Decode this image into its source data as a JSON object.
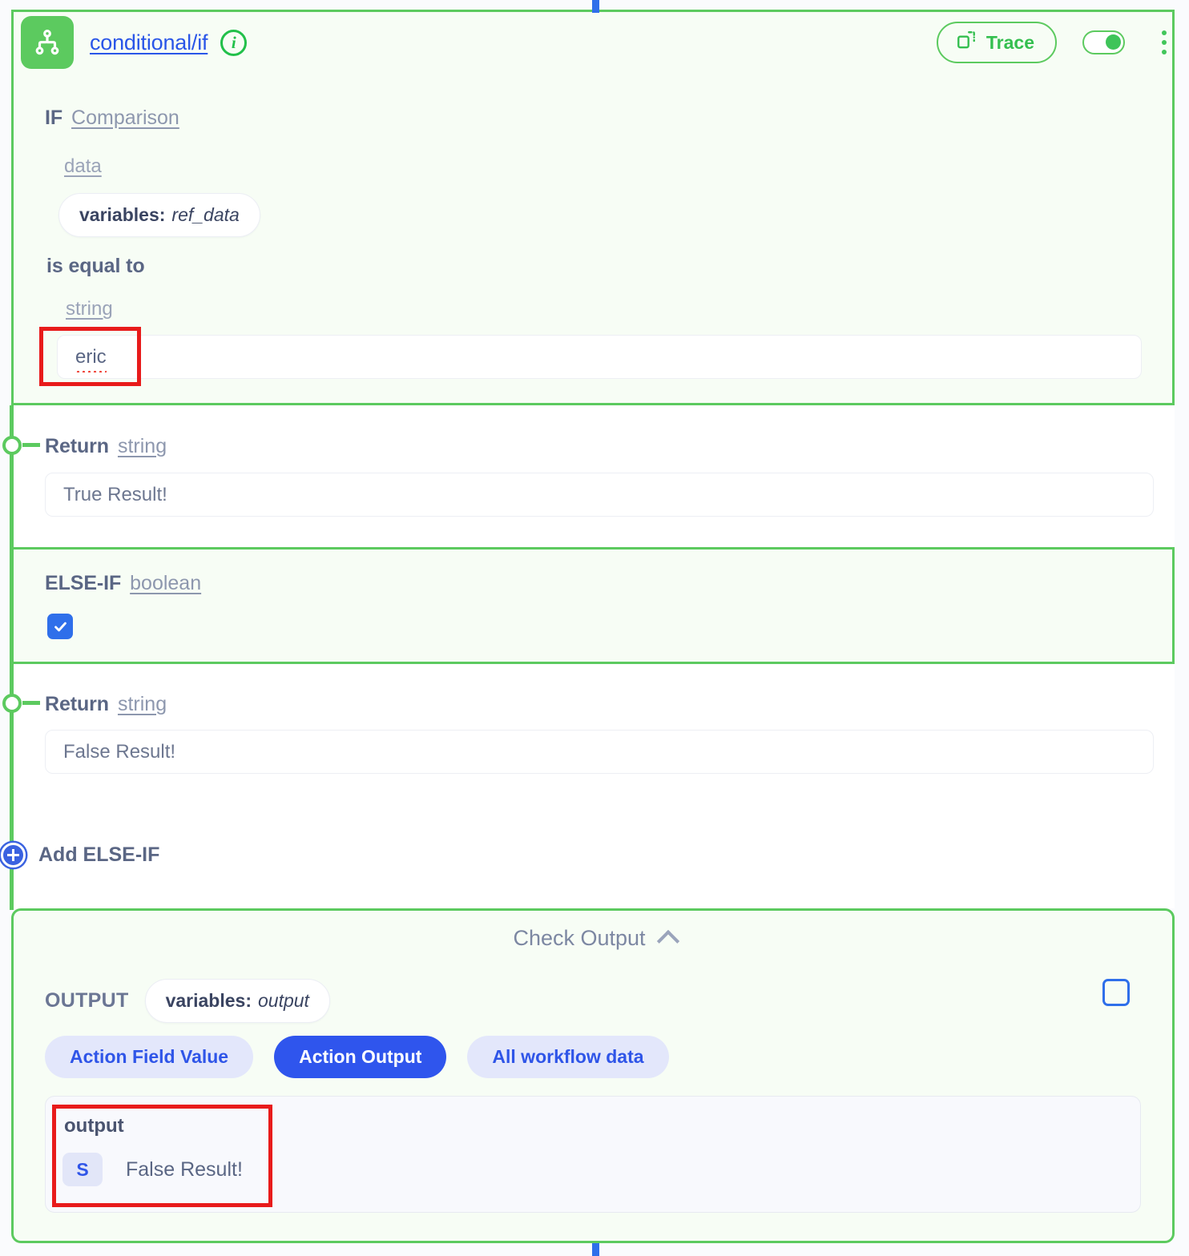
{
  "node": {
    "title": "conditional/if",
    "icon": "branch-fork-icon",
    "info_icon": "i",
    "trace_label": "Trace",
    "toggle_state": "on",
    "menu_icon": "kebab-menu-icon",
    "accent_green": "#5cca5f",
    "accent_blue": "#2f55ed"
  },
  "if_block": {
    "keyword": "IF",
    "condition_type": "Comparison",
    "left_label": "data",
    "left_chip_prefix": "variables:",
    "left_chip_value": "ref_data",
    "operator": "is equal to",
    "right_label": "string",
    "right_value": "eric"
  },
  "return_true": {
    "keyword": "Return",
    "type": "string",
    "placeholder": "True Result!",
    "value": "True Result!"
  },
  "elseif_block": {
    "keyword": "ELSE-IF",
    "type": "boolean",
    "checkbox_checked": true,
    "check_icon": "checkmark-icon"
  },
  "return_false": {
    "keyword": "Return",
    "type": "string",
    "placeholder": "False Result!",
    "value": "False Result!"
  },
  "add_elseif": {
    "label": "Add ELSE-IF",
    "icon": "plus-circle-icon"
  },
  "check_output": {
    "title": "Check Output",
    "collapse_icon": "chevron-up-icon",
    "output_label": "OUTPUT",
    "output_chip_prefix": "variables:",
    "output_chip_value": "output",
    "select_checkbox_checked": false,
    "tabs": [
      {
        "label": "Action Field Value",
        "active": false
      },
      {
        "label": "Action Output",
        "active": true
      },
      {
        "label": "All workflow data",
        "active": false
      }
    ],
    "result": {
      "key": "output",
      "type_badge": "S",
      "value": "False Result!"
    }
  }
}
